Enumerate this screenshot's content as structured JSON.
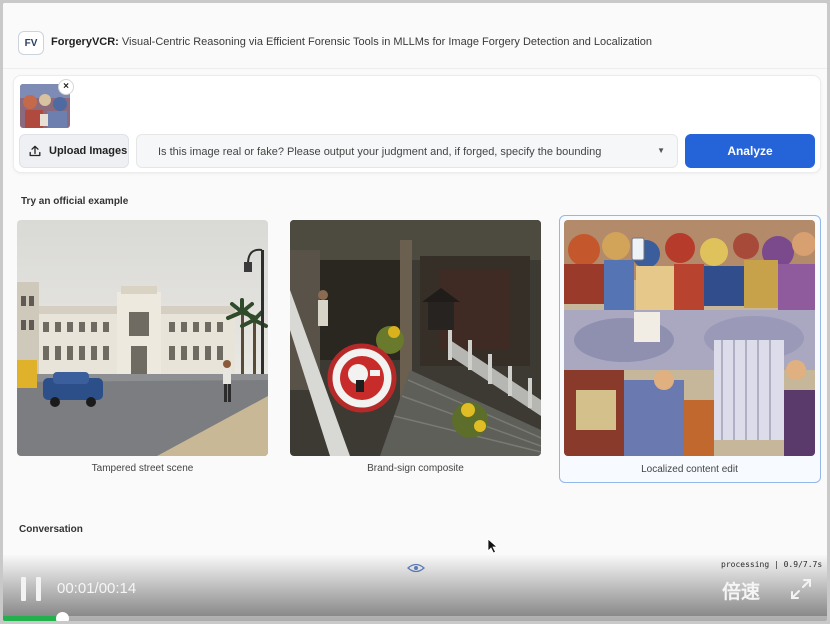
{
  "header": {
    "logo_text": "FV",
    "title_bold": "ForgeryVCR:",
    "title_rest": " Visual-Centric Reasoning via Efficient Forensic Tools in MLLMs for Image Forgery Detection and Localization"
  },
  "input": {
    "thumbnail_close": "×",
    "upload_label": "Upload Images",
    "prompt_text": "Is this image real or fake? Please output your judgment and, if forged, specify the bounding",
    "analyze_label": "Analyze",
    "dropdown_icon": "▼"
  },
  "examples": {
    "heading": "Try an official example",
    "items": [
      {
        "caption": "Tampered street scene"
      },
      {
        "caption": "Brand-sign composite"
      },
      {
        "caption": "Localized content edit"
      }
    ],
    "selected_index": 2
  },
  "conversation": {
    "heading": "Conversation"
  },
  "player": {
    "status": "processing | 0.9/7.7s",
    "time": "00:01/00:14",
    "speed_label": "倍速",
    "progress_fraction": 0.071,
    "progress_color": "#22b14c"
  },
  "colors": {
    "accent": "#2563d8",
    "selected_border": "#93b7e9"
  }
}
